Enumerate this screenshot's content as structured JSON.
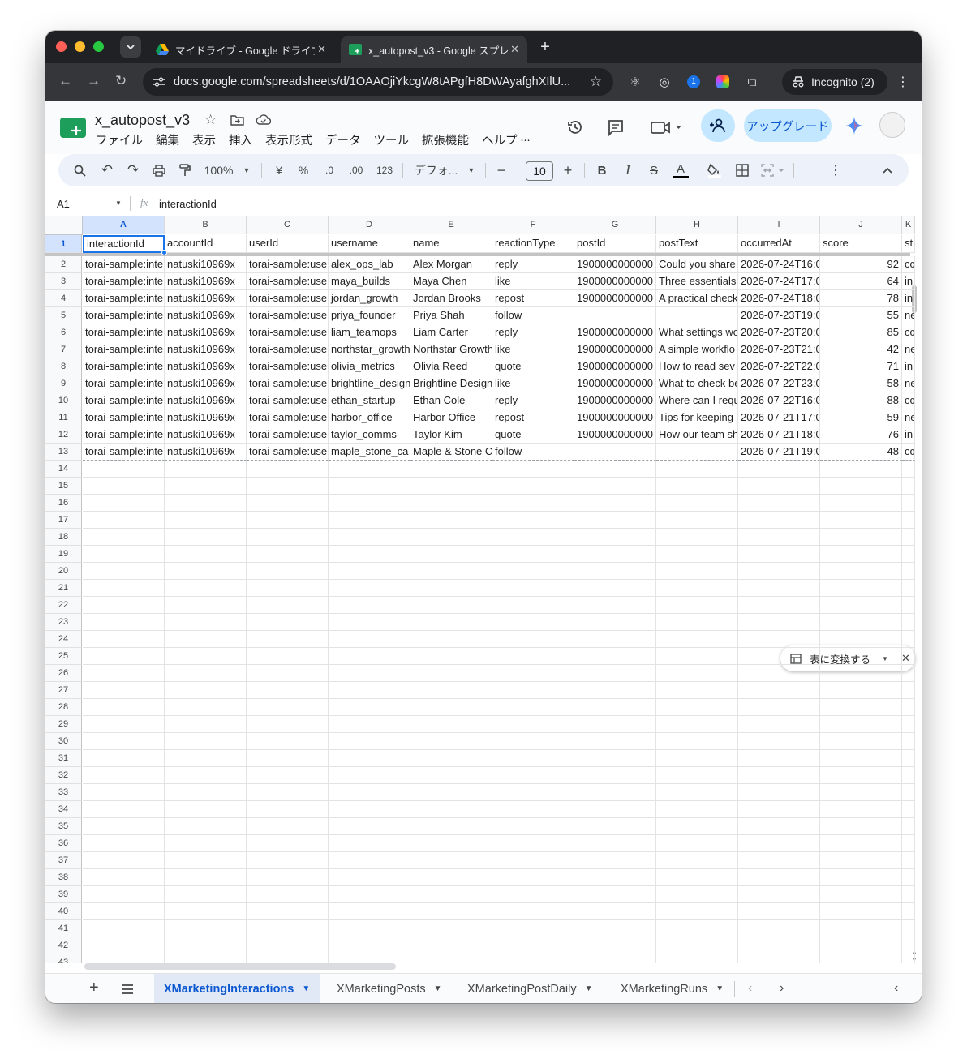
{
  "browser": {
    "tabs": [
      {
        "title": "マイドライブ - Google ドライブ",
        "active": false
      },
      {
        "title": "x_autopost_v3 - Google スプレ",
        "active": true
      }
    ],
    "url": "docs.google.com/spreadsheets/d/1OAAOjiYkcgW8tAPgfH8DWAyafghXIlU...",
    "incognito_label": "Incognito (2)"
  },
  "app": {
    "doc_title": "x_autopost_v3",
    "menus": [
      "ファイル",
      "編集",
      "表示",
      "挿入",
      "表示形式",
      "データ",
      "ツール",
      "拡張機能",
      "ヘルプ",
      "..."
    ],
    "upgrade_label": "アップグレード"
  },
  "format_toolbar": {
    "zoom": "100%",
    "currency": "¥",
    "percent": "%",
    "dec_minus": ".0",
    "dec_plus": ".00",
    "number_format": "123",
    "font": "デフォ...",
    "font_size": "10"
  },
  "formula_bar": {
    "cell_ref": "A1",
    "fx": "fx",
    "value": "interactionId"
  },
  "sheet": {
    "columns": [
      "A",
      "B",
      "C",
      "D",
      "E",
      "F",
      "G",
      "H",
      "I",
      "J",
      "K"
    ],
    "header": [
      "interactionId",
      "accountId",
      "userId",
      "username",
      "name",
      "reactionType",
      "postId",
      "postText",
      "occurredAt",
      "score",
      "st"
    ],
    "rows": [
      [
        "torai-sample:inte",
        "natuski10969x",
        "torai-sample:use",
        "alex_ops_lab",
        "Alex Morgan",
        "reply",
        "1900000000000",
        "Could you share",
        "2026-07-24T16:0",
        "92",
        "co"
      ],
      [
        "torai-sample:inte",
        "natuski10969x",
        "torai-sample:use",
        "maya_builds",
        "Maya Chen",
        "like",
        "1900000000000",
        "Three essentials",
        "2026-07-24T17:0",
        "64",
        "in"
      ],
      [
        "torai-sample:inte",
        "natuski10969x",
        "torai-sample:use",
        "jordan_growth",
        "Jordan Brooks",
        "repost",
        "1900000000000",
        "A practical check",
        "2026-07-24T18:0",
        "78",
        "in"
      ],
      [
        "torai-sample:inte",
        "natuski10969x",
        "torai-sample:use",
        "priya_founder",
        "Priya Shah",
        "follow",
        "",
        "",
        "2026-07-23T19:0",
        "55",
        "ne"
      ],
      [
        "torai-sample:inte",
        "natuski10969x",
        "torai-sample:use",
        "liam_teamops",
        "Liam Carter",
        "reply",
        "1900000000000",
        "What settings wo",
        "2026-07-23T20:0",
        "85",
        "co"
      ],
      [
        "torai-sample:inte",
        "natuski10969x",
        "torai-sample:use",
        "northstar_growth",
        "Northstar Growth",
        "like",
        "1900000000000",
        "A simple workflo",
        "2026-07-23T21:0",
        "42",
        "ne"
      ],
      [
        "torai-sample:inte",
        "natuski10969x",
        "torai-sample:use",
        "olivia_metrics",
        "Olivia Reed",
        "quote",
        "1900000000000",
        "How to read sev",
        "2026-07-22T22:0",
        "71",
        "in"
      ],
      [
        "torai-sample:inte",
        "natuski10969x",
        "torai-sample:use",
        "brightline_design",
        "Brightline Design",
        "like",
        "1900000000000",
        "What to check be",
        "2026-07-22T23:0",
        "58",
        "ne"
      ],
      [
        "torai-sample:inte",
        "natuski10969x",
        "torai-sample:use",
        "ethan_startup",
        "Ethan Cole",
        "reply",
        "1900000000000",
        "Where can I requ",
        "2026-07-22T16:0",
        "88",
        "co"
      ],
      [
        "torai-sample:inte",
        "natuski10969x",
        "torai-sample:use",
        "harbor_office",
        "Harbor Office",
        "repost",
        "1900000000000",
        "Tips for keeping",
        "2026-07-21T17:0",
        "59",
        "ne"
      ],
      [
        "torai-sample:inte",
        "natuski10969x",
        "torai-sample:use",
        "taylor_comms",
        "Taylor Kim",
        "quote",
        "1900000000000",
        "How our team sh",
        "2026-07-21T18:0",
        "76",
        "in"
      ],
      [
        "torai-sample:inte",
        "natuski10969x",
        "torai-sample:use",
        "maple_stone_ca",
        "Maple & Stone C",
        "follow",
        "",
        "",
        "2026-07-21T19:0",
        "48",
        "co"
      ]
    ],
    "row_numbers": [
      "1",
      "2",
      "3",
      "4",
      "5",
      "6",
      "7",
      "8",
      "9",
      "10",
      "11",
      "12",
      "13",
      "14",
      "15",
      "16",
      "17",
      "18",
      "19",
      "20",
      "21",
      "22",
      "23",
      "24",
      "25",
      "26",
      "27",
      "28",
      "29",
      "30",
      "31",
      "32",
      "33",
      "34",
      "35",
      "36",
      "37",
      "38",
      "39",
      "40",
      "41",
      "42",
      "43"
    ]
  },
  "convert_chip": {
    "label": "表に変換する"
  },
  "sheet_tabs": [
    {
      "label": "XMarketingInteractions",
      "active": true
    },
    {
      "label": "XMarketingPosts",
      "active": false
    },
    {
      "label": "XMarketingPostDaily",
      "active": false
    },
    {
      "label": "XMarketingRuns",
      "active": false
    }
  ],
  "colors": {
    "chrome_dark": "#202124",
    "chrome_toolbar": "#35363a",
    "accent_blue": "#0b57d0",
    "selection_blue": "#1a73e8",
    "share_bg": "#c2e7ff",
    "sheets_green": "#1e9e5b"
  }
}
